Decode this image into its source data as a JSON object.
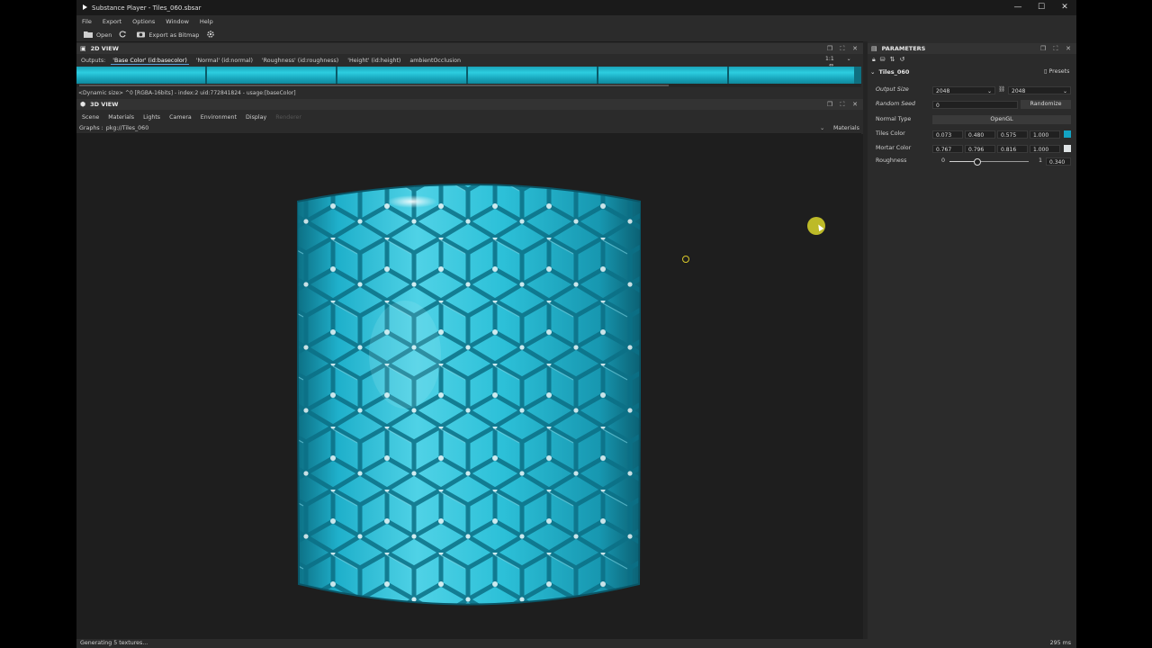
{
  "window": {
    "title": "Substance Player - Tiles_060.sbsar",
    "controls": [
      "—",
      "☐",
      "✕"
    ]
  },
  "menu": [
    "File",
    "Export",
    "Options",
    "Window",
    "Help"
  ],
  "toolbar": {
    "open_label": "Open",
    "export_label": "Export as Bitmap"
  },
  "view2d": {
    "title": "2D VIEW",
    "outputs_label": "Outputs:",
    "outputs": [
      "'Base Color' (id:basecolor)",
      "'Normal' (id:normal)",
      "'Roughness' (id:roughness)",
      "'Height' (id:height)",
      "ambientOcclusion"
    ],
    "selected_output": 0,
    "zoom": "1:1",
    "info": "<Dynamic size> ^0 [RGBA-16bits] - index:2 uid:772841824 - usage:[baseColor]",
    "strip_color": "#1bb6cd"
  },
  "view3d": {
    "title": "3D VIEW",
    "tabs": [
      "Scene",
      "Materials",
      "Lights",
      "Camera",
      "Environment",
      "Display",
      "Renderer"
    ],
    "graphs_label": "Graphs :",
    "graphs_value": "pkg://Tiles_060",
    "materials_label": "Materials"
  },
  "parameters": {
    "title": "PARAMETERS",
    "graph_name": "Tiles_060",
    "presets_label": "Presets",
    "output_size": {
      "label": "Output Size",
      "w": "2048",
      "h": "2048"
    },
    "random_seed": {
      "label": "Random Seed",
      "value": "0",
      "button": "Randomize"
    },
    "normal_type": {
      "label": "Normal Type",
      "value": "OpenGL"
    },
    "tiles_color": {
      "label": "Tiles Color",
      "r": "0.073",
      "g": "0.480",
      "b": "0.575",
      "a": "1.000",
      "swatch": "#13a3c4"
    },
    "mortar_color": {
      "label": "Mortar Color",
      "r": "0.767",
      "g": "0.796",
      "b": "0.816",
      "a": "1.000",
      "swatch": "#dfe4e6"
    },
    "roughness": {
      "label": "Roughness",
      "min": "0",
      "max": "1",
      "value": "0.340",
      "fraction": 0.34
    }
  },
  "status": {
    "text": "Generating 5 textures...",
    "time": "295 ms"
  },
  "colors": {
    "accent": "#5aa0d8",
    "tile": "#23b7d3",
    "background": "#1e1e1e"
  }
}
